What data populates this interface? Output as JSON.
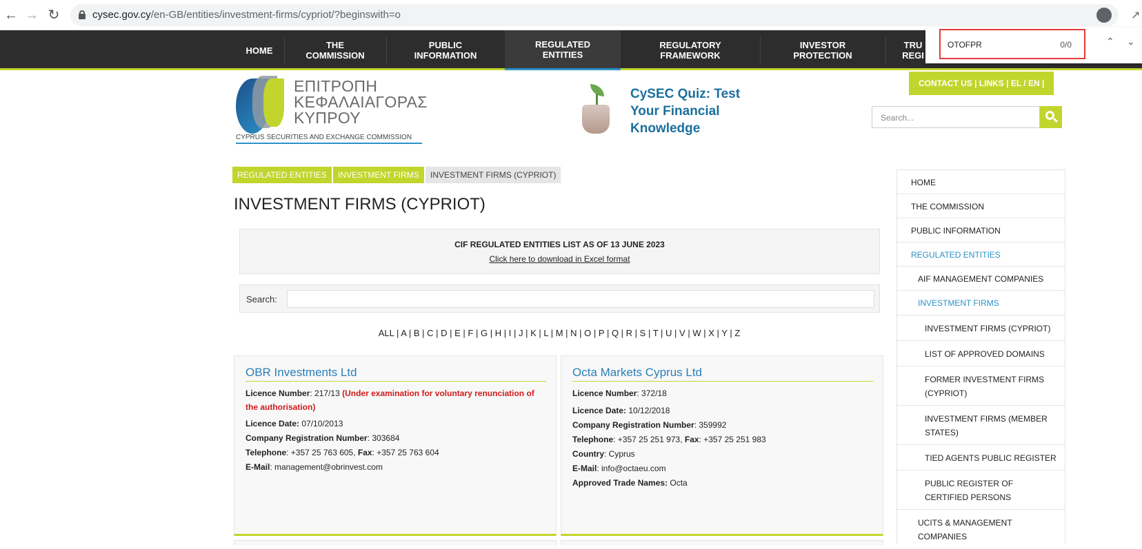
{
  "browser": {
    "url_host": "cysec.gov.cy",
    "url_path": "/en-GB/entities/investment-firms/cypriot/?beginswith=o"
  },
  "find": {
    "query": "OTOFPR",
    "count": "0/0"
  },
  "nav": {
    "items": [
      {
        "label": "HOME"
      },
      {
        "label": "THE\nCOMMISSION"
      },
      {
        "label": "PUBLIC\nINFORMATION"
      },
      {
        "label": "REGULATED\nENTITIES"
      },
      {
        "label": "REGULATORY\nFRAMEWORK"
      },
      {
        "label": "INVESTOR\nPROTECTION"
      },
      {
        "label": "TRU\nREGI"
      }
    ]
  },
  "logo": {
    "line1": "ΕΠΙΤΡΟΠΗ",
    "line2": "ΚΕΦΑΛΑΙΑΓΟΡΑΣ",
    "line3": "ΚΥΠΡΟΥ",
    "sub": "CYPRUS SECURITIES AND EXCHANGE COMMISSION"
  },
  "quiz": {
    "text": "CySEC Quiz: Test Your Financial Knowledge"
  },
  "header": {
    "contact": "CONTACT US  |  LINKS  |   EL / EN |",
    "search_placeholder": "Search..."
  },
  "breadcrumb": [
    "REGULATED ENTITIES",
    "INVESTMENT FIRMS",
    "INVESTMENT FIRMS (CYPRIOT)"
  ],
  "page_title": "INVESTMENT FIRMS (CYPRIOT)",
  "cif": {
    "title": "CIF REGULATED ENTITIES LIST AS OF 13 JUNE 2023",
    "link": "Click here to download in Excel format"
  },
  "search": {
    "label": "Search:"
  },
  "alphabet": [
    "ALL",
    "A",
    "B",
    "C",
    "D",
    "E",
    "F",
    "G",
    "H",
    "I",
    "J",
    "K",
    "L",
    "M",
    "N",
    "O",
    "P",
    "Q",
    "R",
    "S",
    "T",
    "U",
    "V",
    "W",
    "X",
    "Y",
    "Z"
  ],
  "firms": [
    {
      "name": "OBR Investments Ltd",
      "licence_number": "217/13",
      "licence_note": "(Under examination for voluntary renunciation of the authorisation)",
      "licence_date": "07/10/2013",
      "company_reg": "303684",
      "telephone": "+357 25 763 605",
      "fax": "+357 25 763 604",
      "email": "management@obrinvest.com"
    },
    {
      "name": "Octa Markets Cyprus Ltd",
      "licence_number": "372/18",
      "licence_date": "10/12/2018",
      "company_reg": "359992",
      "telephone": "+357 25 251 973",
      "fax": "+357 25 251 983",
      "country": "Cyprus",
      "email": "info@octaeu.com",
      "trade_names": "Octa"
    }
  ],
  "labels": {
    "licence_number": "Licence Number",
    "licence_date": "Licence Date:",
    "company_reg": "Company Registration Number",
    "telephone": "Telephone",
    "fax": "Fax",
    "country": "Country",
    "email": "E-Mail",
    "trade_names": "Approved Trade Names:"
  },
  "sidebar": [
    {
      "label": "HOME"
    },
    {
      "label": "THE COMMISSION"
    },
    {
      "label": "PUBLIC INFORMATION"
    },
    {
      "label": "REGULATED ENTITIES"
    },
    {
      "label": "AIF MANAGEMENT COMPANIES"
    },
    {
      "label": "INVESTMENT FIRMS"
    },
    {
      "label": "INVESTMENT FIRMS (CYPRIOT)"
    },
    {
      "label": "LIST OF APPROVED DOMAINS"
    },
    {
      "label": "FORMER INVESTMENT FIRMS (CYPRIOT)"
    },
    {
      "label": "INVESTMENT FIRMS (MEMBER STATES)"
    },
    {
      "label": "TIED AGENTS PUBLIC REGISTER"
    },
    {
      "label": "PUBLIC REGISTER OF CERTIFIED PERSONS"
    },
    {
      "label": "UCITS & MANAGEMENT COMPANIES"
    }
  ],
  "colors": {
    "accent_green": "#c2d52c",
    "accent_blue": "#2a91c7",
    "nav_bg": "#2d2d2d"
  }
}
